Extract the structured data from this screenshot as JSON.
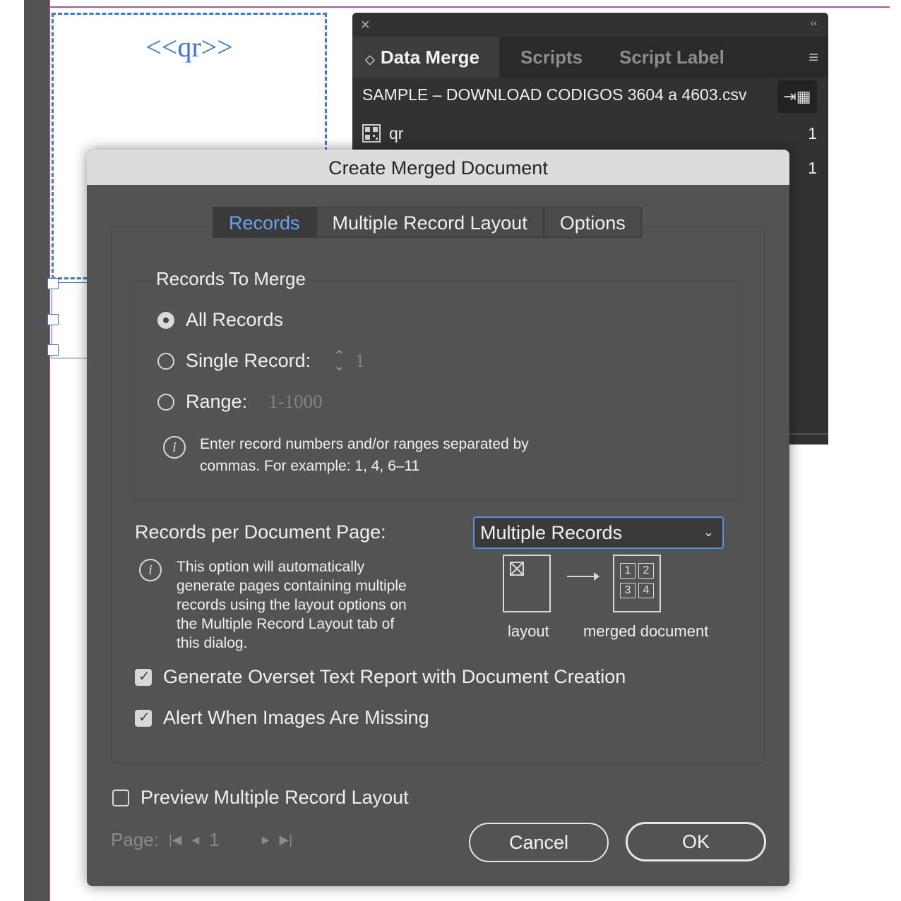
{
  "canvas": {
    "placeholder": "<<qr>>"
  },
  "data_merge_panel": {
    "tabs": [
      {
        "label": "Data Merge",
        "prefix": "◇",
        "active": true
      },
      {
        "label": "Scripts",
        "active": false
      },
      {
        "label": "Script Label",
        "active": false
      }
    ],
    "source_file": "SAMPLE – DOWNLOAD CODIGOS 3604 a 4603.csv",
    "fields": [
      {
        "name": "qr",
        "value": "1"
      },
      {
        "name": "",
        "value": "1"
      }
    ],
    "icons": {
      "close": "close-icon",
      "collapse": "collapse-icon",
      "menu": "panel-menu-icon",
      "import": "import-data-icon",
      "field": "qr-field-icon"
    }
  },
  "dialog": {
    "title": "Create Merged Document",
    "tabs": [
      "Records",
      "Multiple Record Layout",
      "Options"
    ],
    "active_tab": "Records",
    "records_to_merge": {
      "heading": "Records To Merge",
      "all_records": "All Records",
      "single_record": "Single Record:",
      "single_record_value": "1",
      "range": "Range:",
      "range_value": "1-1000",
      "selected": "All Records",
      "info_line1": "Enter record numbers and/or ranges separated by",
      "info_line2": "commas. For example: 1, 4, 6–11"
    },
    "records_per_page": {
      "label": "Records per Document Page:",
      "value": "Multiple Records",
      "info": [
        "This option will automatically",
        "generate pages containing multiple",
        "records using the layout options on",
        "the Multiple Record Layout tab of",
        "this dialog."
      ],
      "diagram": {
        "layout_caption": "layout",
        "merged_caption": "merged document",
        "cells": [
          "1",
          "2",
          "3",
          "4"
        ]
      }
    },
    "checkboxes": {
      "overset": {
        "label": "Generate Overset Text Report with Document Creation",
        "checked": true
      },
      "images": {
        "label": "Alert When Images Are Missing",
        "checked": true
      },
      "preview": {
        "label": "Preview Multiple Record Layout",
        "checked": false
      }
    },
    "page_nav": {
      "label": "Page:",
      "value": "1"
    },
    "buttons": {
      "cancel": "Cancel",
      "ok": "OK"
    }
  }
}
